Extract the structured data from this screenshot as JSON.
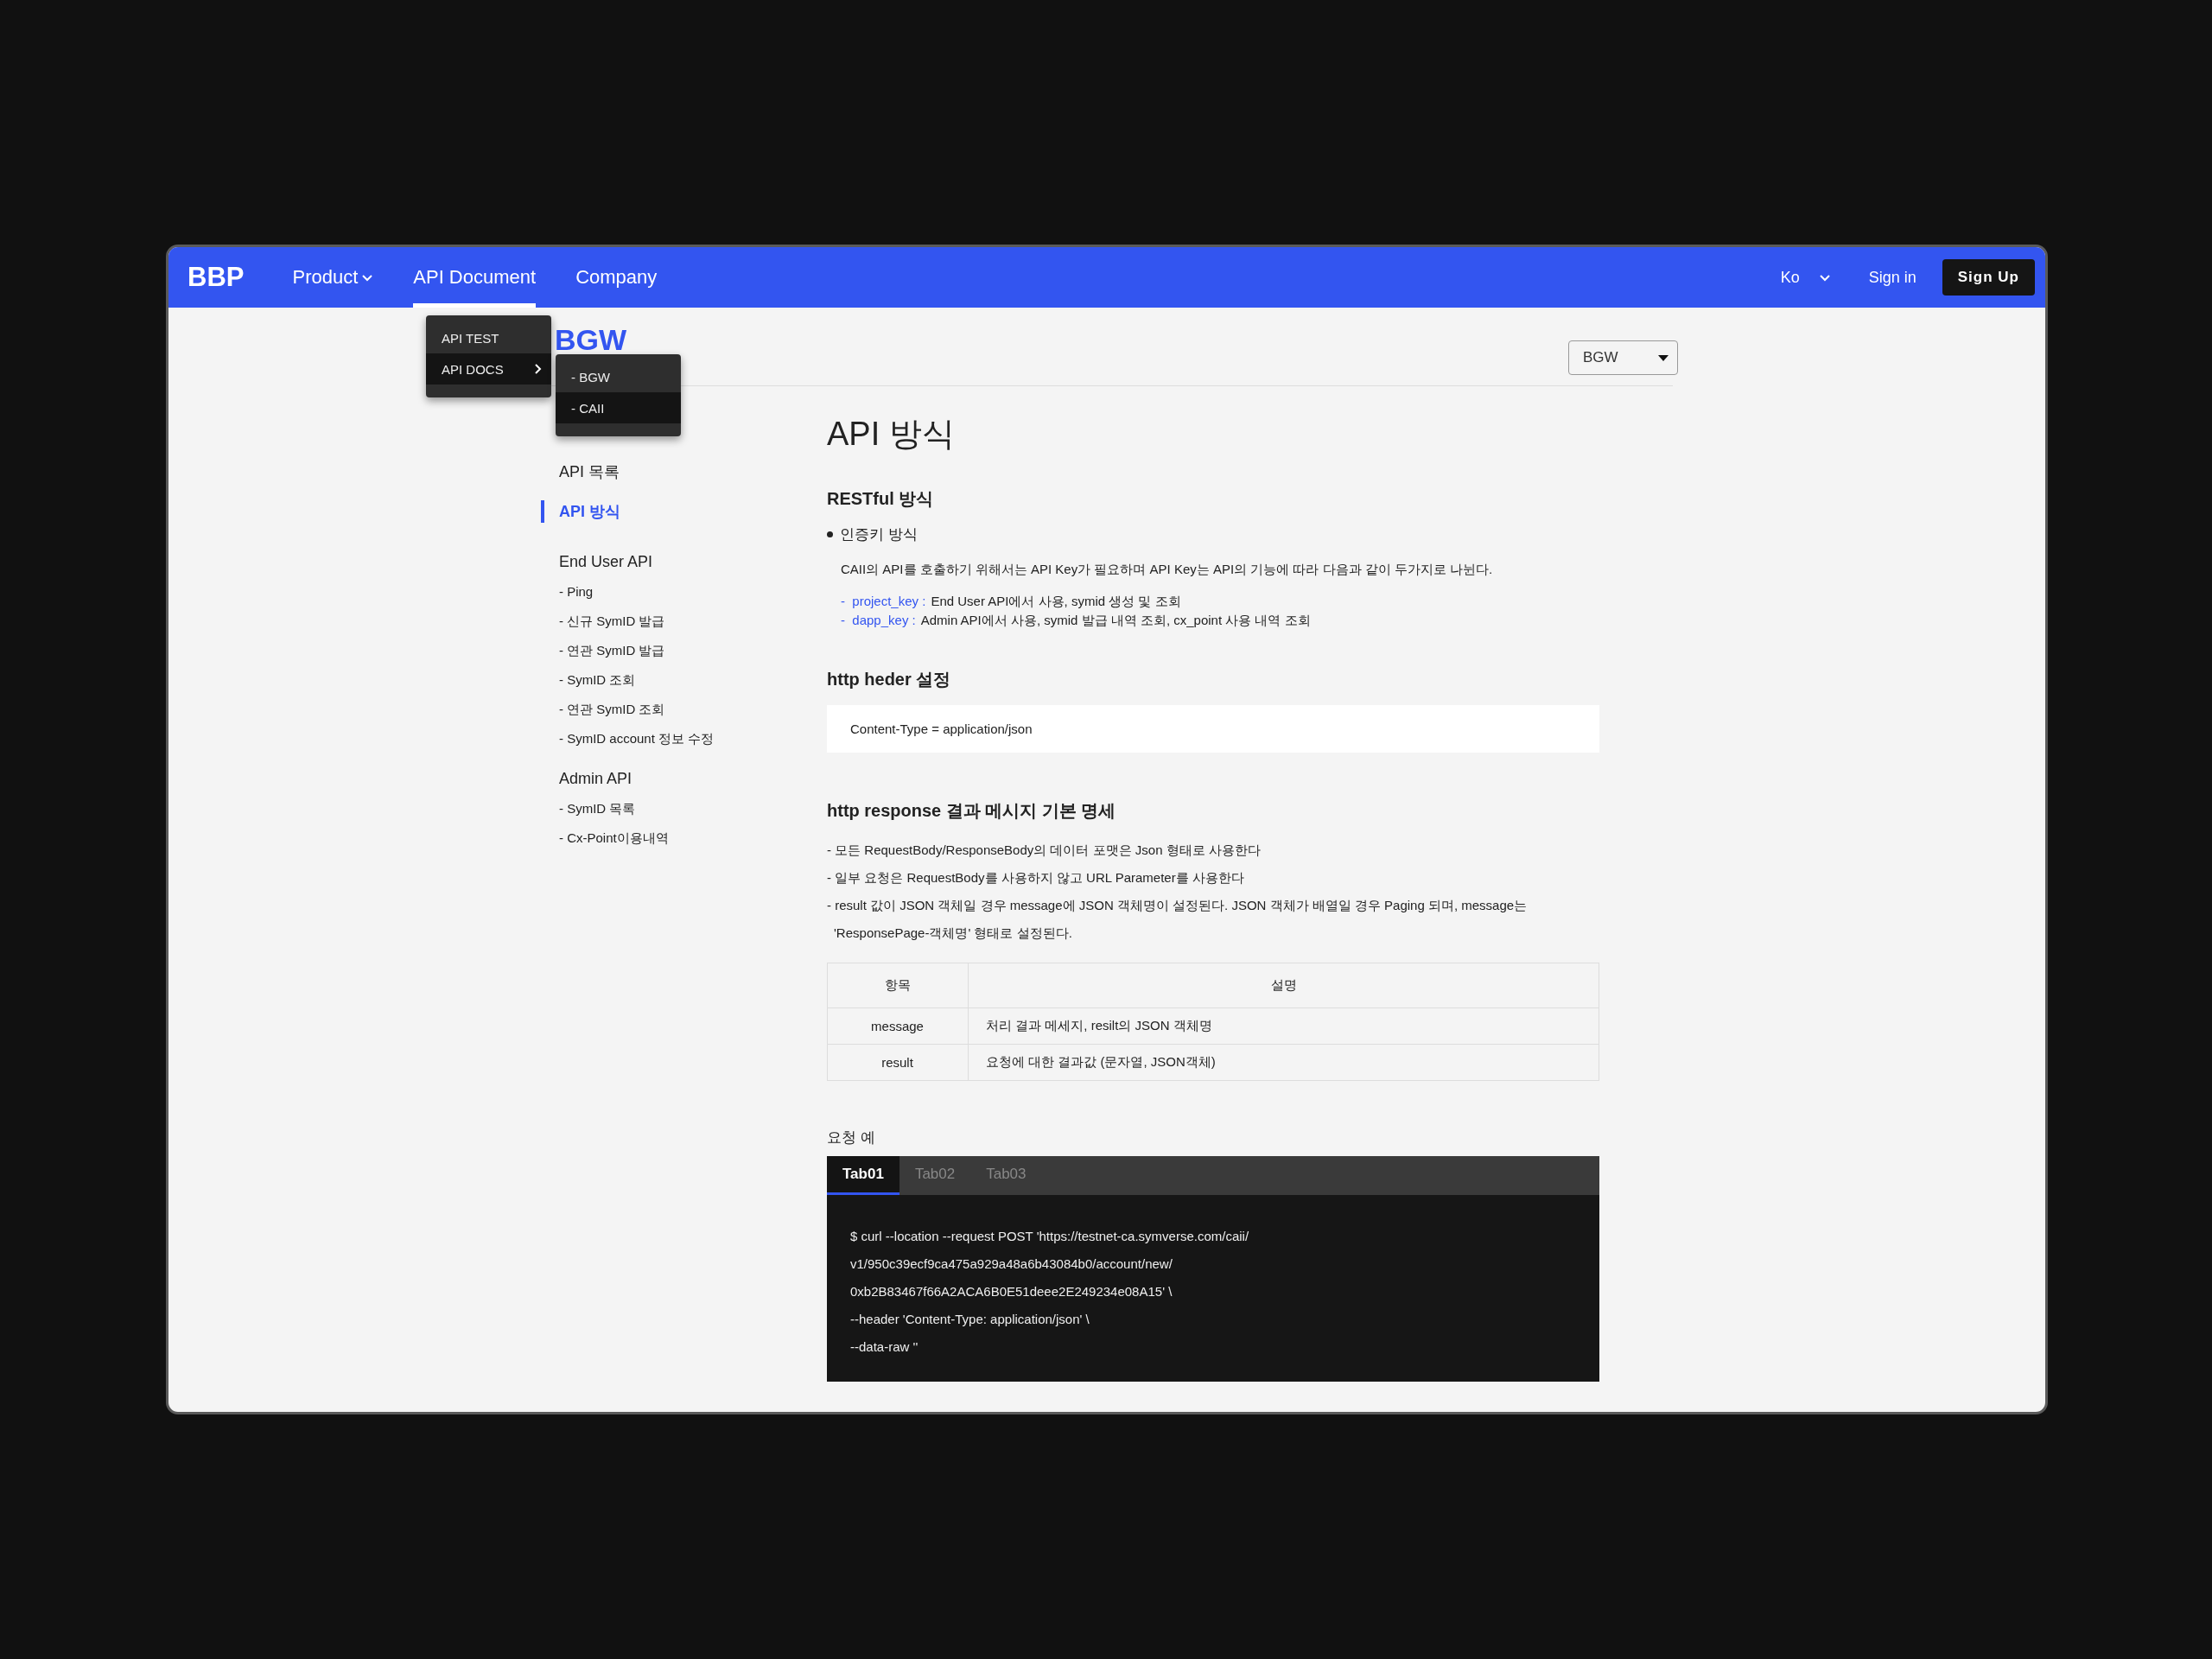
{
  "header": {
    "logo": "BBP",
    "nav": [
      {
        "label": "Product",
        "dropdown": true,
        "selected": false
      },
      {
        "label": "API Document",
        "dropdown": false,
        "selected": true
      },
      {
        "label": "Company",
        "dropdown": false,
        "selected": false
      }
    ],
    "language": "Ko",
    "sign_in": "Sign in",
    "sign_up": "Sign Up"
  },
  "nav_menu": {
    "items": [
      {
        "label": "API TEST",
        "selected": false,
        "submenu": false
      },
      {
        "label": "API DOCS",
        "selected": true,
        "submenu": true
      }
    ]
  },
  "submenu": {
    "items": [
      {
        "label": "- BGW",
        "selected": false
      },
      {
        "label": "- CAII",
        "selected": true
      }
    ]
  },
  "page": {
    "title": "BGW",
    "select": {
      "value": "BGW"
    }
  },
  "sidebar": {
    "items": [
      {
        "label": "API 목록",
        "selected": false
      },
      {
        "label": "API 방식",
        "selected": true
      },
      {
        "label": "End User API",
        "selected": false,
        "children": [
          {
            "label": "- Ping",
            "selected": false
          },
          {
            "label": "- 신규 SymID 발급",
            "selected": false
          },
          {
            "label": "- 연관 SymID 발급",
            "selected": false
          },
          {
            "label": "- SymID 조회",
            "selected": false
          },
          {
            "label": "- 연관 SymID 조회",
            "selected": false
          },
          {
            "label": "- SymID account 정보 수정",
            "selected": false
          }
        ]
      },
      {
        "label": "Admin API",
        "selected": false,
        "children": [
          {
            "label": "- SymID 목록",
            "selected": false
          },
          {
            "label": "- Cx-Point이용내역",
            "selected": false
          }
        ]
      }
    ]
  },
  "article": {
    "title": "API 방식",
    "restful": {
      "heading": "RESTful 방식",
      "bullet": "인증키 방식",
      "text": "CAII의 API를 호출하기 위해서는 API Key가 필요하며 API Key는 API의 기능에 따라 다음과 같이 두가지로 나뉜다.",
      "keys": [
        {
          "marker": "-",
          "name": "project_key :",
          "desc": "End User API에서 사용, symid 생성 및 조회"
        },
        {
          "marker": "-",
          "name": "dapp_key :",
          "desc": "Admin API에서 사용, symid 발급 내역 조회, cx_point 사용 내역 조회"
        }
      ]
    },
    "header_section": {
      "heading": "http heder 설정",
      "code": "Content-Type = application/json"
    },
    "response_section": {
      "heading": "http response 결과 메시지 기본 명세",
      "notes": [
        "- 모든 RequestBody/ResponseBody의 데이터 포맷은 Json 형태로 사용한다",
        "- 일부 요청은 RequestBody를 사용하지 않고 URL Parameter를 사용한다",
        "- result 값이 JSON 객체일 경우 message에 JSON 객체명이 설정된다.  JSON 객체가 배열일 경우 Paging 되며, message는 'ResponsePage-객체명' 형태로 설정된다."
      ],
      "table": {
        "columns": [
          "항목",
          "설명"
        ],
        "rows": [
          [
            "message",
            "처리 결과 메세지, resilt의 JSON 객체명"
          ],
          [
            "result",
            "요청에 대한 결과값 (문자열, JSON객체)"
          ]
        ]
      }
    },
    "example": {
      "heading": "요청 예",
      "tabs": [
        {
          "label": "Tab01",
          "selected": true
        },
        {
          "label": "Tab02",
          "selected": false
        },
        {
          "label": "Tab03",
          "selected": false
        }
      ],
      "code_lines": [
        "$ curl --location --request POST 'https://testnet-ca.symverse.com/caii/",
        "v1/950c39ecf9ca475a929a48a6b43084b0/account/new/",
        "0xb2B83467f66A2ACA6B0E51deee2E249234e08A15' \\",
        "--header 'Content-Type: application/json' \\",
        "--data-raw ''"
      ]
    }
  }
}
